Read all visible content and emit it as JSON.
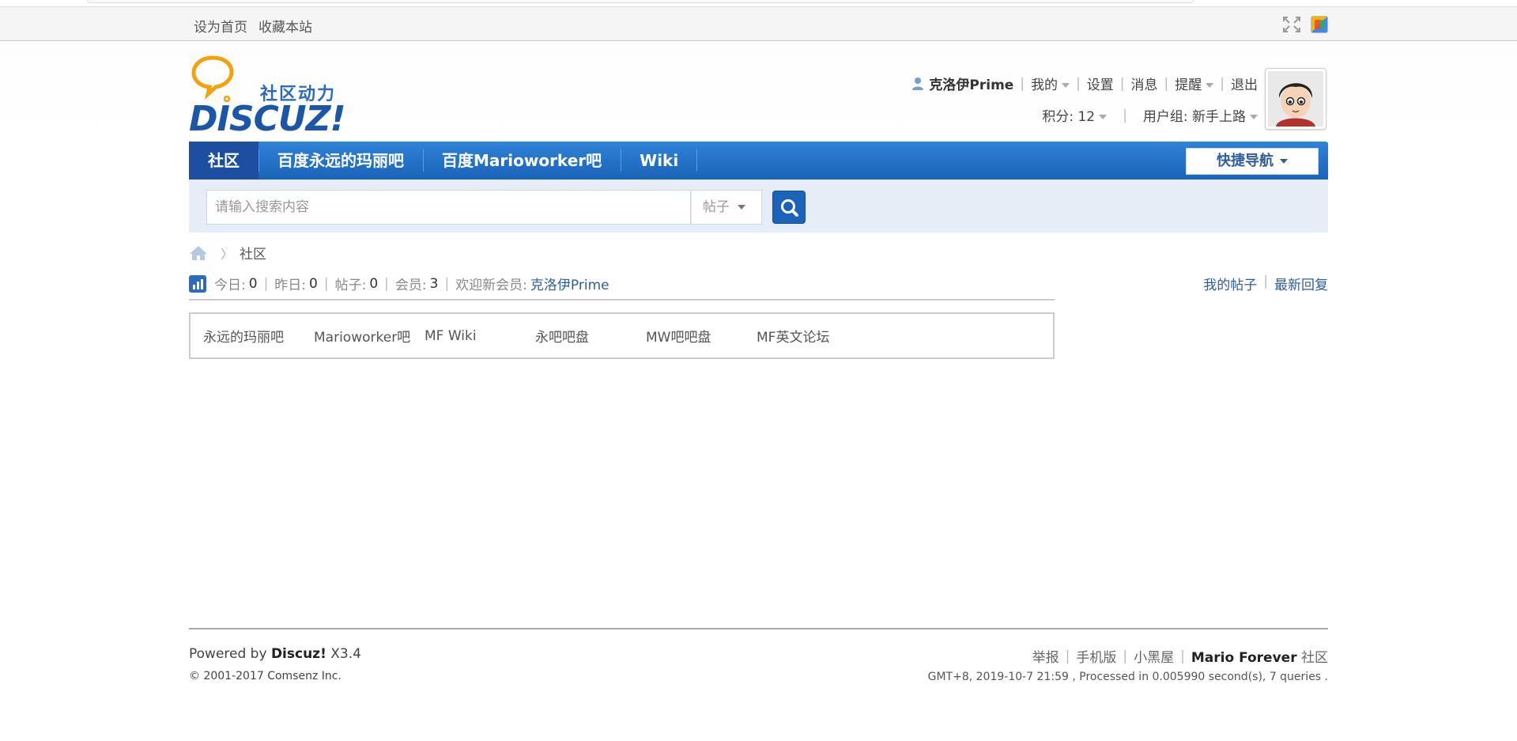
{
  "toptb": {
    "set_home": "设为首页",
    "bookmark": "收藏本站"
  },
  "logo": {
    "tagline": "社区动力",
    "wordmark": "DISCUZ!"
  },
  "user": {
    "username": "克洛伊Prime",
    "menu": [
      "我的",
      "设置",
      "消息",
      "提醒",
      "退出"
    ],
    "points_label": "积分: 12",
    "group_label": "用户组: 新手上路"
  },
  "nav": {
    "items": [
      "社区",
      "百度永远的玛丽吧",
      "百度Marioworker吧",
      "Wiki"
    ],
    "quick_nav": "快捷导航"
  },
  "search": {
    "placeholder": "请输入搜索内容",
    "type": "帖子"
  },
  "breadcrumb": {
    "current": "社区"
  },
  "stats": {
    "today_label": "今日:",
    "today": "0",
    "yesterday_label": "昨日:",
    "yesterday": "0",
    "posts_label": "帖子:",
    "posts": "0",
    "members_label": "会员:",
    "members": "3",
    "new_member_label": "欢迎新会员:",
    "new_member": "克洛伊Prime",
    "my_posts": "我的帖子",
    "latest_reply": "最新回复"
  },
  "friend_links": [
    "永远的玛丽吧",
    "Marioworker吧",
    "MF Wiki",
    "永吧吧盘",
    "MW吧吧盘",
    "MF英文论坛"
  ],
  "footer": {
    "powered_prefix": "Powered by",
    "powered_name": "Discuz!",
    "version": "X3.4",
    "copyright": "© 2001-2017 Comsenz Inc.",
    "links": [
      "举报",
      "手机版",
      "小黑屋"
    ],
    "site_name": "Mario Forever",
    "site_suffix": "社区",
    "time_info": "GMT+8, 2019-10-7 21:59 , Processed in 0.005990 second(s), 7 queries ."
  },
  "colors": {
    "nav_blue": "#1a63b8",
    "link_blue": "#2e5e9e",
    "search_band": "#e7edf6"
  }
}
